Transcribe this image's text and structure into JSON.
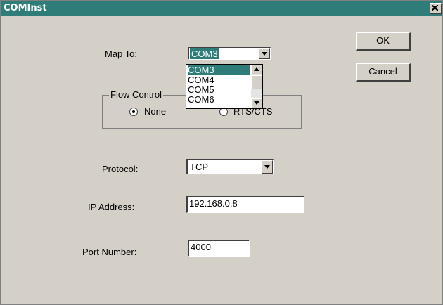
{
  "window": {
    "title": "COMInst"
  },
  "buttons": {
    "ok": "OK",
    "cancel": "Cancel"
  },
  "map_to": {
    "label": "Map To:",
    "selected": "COM3",
    "options": [
      "COM3",
      "COM4",
      "COM5",
      "COM6"
    ]
  },
  "flow_control": {
    "label": "Flow Control",
    "options": [
      {
        "label": "None",
        "checked": true
      },
      {
        "label": "RTS/CTS",
        "checked": false
      }
    ]
  },
  "protocol": {
    "label": "Protocol:",
    "value": "TCP"
  },
  "ip_address": {
    "label": "IP Address:",
    "value": "192.168.0.8"
  },
  "port_number": {
    "label": "Port Number:",
    "value": "4000"
  },
  "colors": {
    "titlebar": "#2e7d78",
    "face": "#d4d0c8",
    "selection": "#2e7d78"
  },
  "icons": {
    "close": "close-icon",
    "dropdown": "chevron-down-icon"
  }
}
